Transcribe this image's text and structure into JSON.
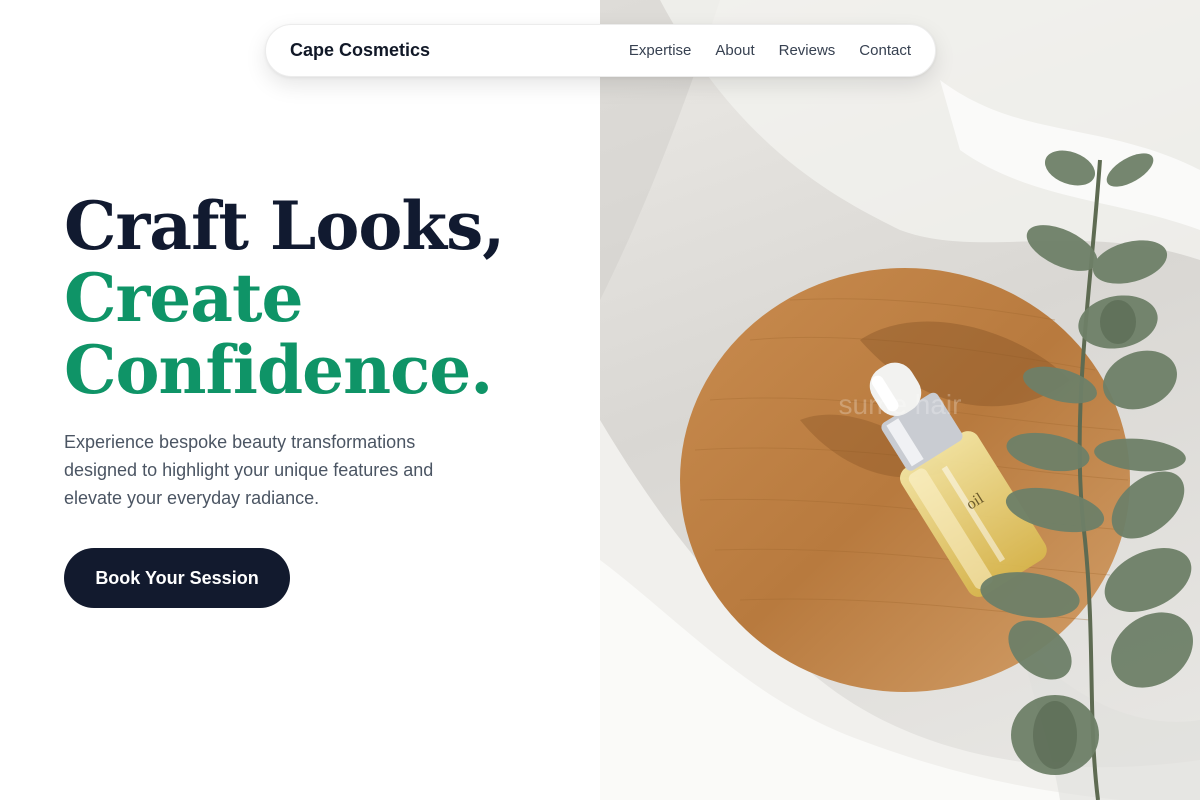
{
  "nav": {
    "brand": "Cape Cosmetics",
    "links": [
      "Expertise",
      "About",
      "Reviews",
      "Contact"
    ]
  },
  "hero": {
    "headline_line1": "Craft Looks,",
    "headline_line2": "Create",
    "headline_line3": "Confidence.",
    "subtitle": "Experience bespoke beauty transformations designed to highlight your unique features and elevate your everyday radiance.",
    "cta_label": "Book Your Session"
  },
  "image": {
    "watermark": "sume hair",
    "bottle_label": "oil"
  },
  "colors": {
    "headline_dark": "#111a30",
    "headline_accent": "#0f9467",
    "button_bg": "#121a2e",
    "body_text": "#4b5563"
  }
}
